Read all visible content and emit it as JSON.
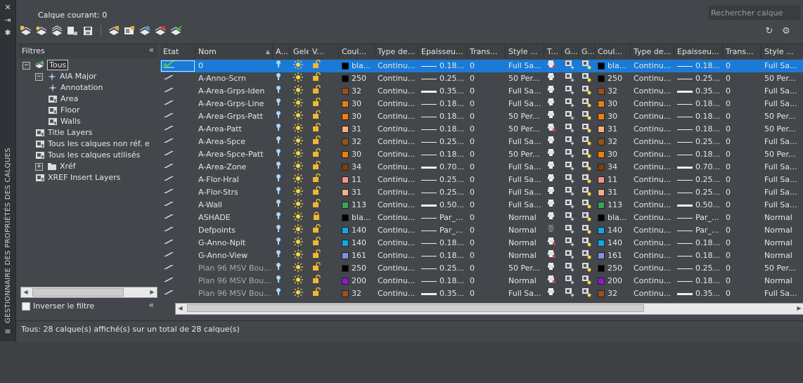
{
  "panel_title": "GESTIONNAIRE DES PROPRIÉTÉS DES CALQUES",
  "current_layer_label": "Calque courant: 0",
  "search_placeholder": "Rechercher calque",
  "filters_title": "Filtres",
  "invert_filter_label": "Inverser le filtre",
  "status_text": "Tous: 28 calque(s) affiché(s) sur un total de 28 calque(s)",
  "filter_tree": [
    {
      "label": "Tous",
      "level": 0,
      "expander": "minus",
      "icon": "filter-all-icon",
      "selected": true
    },
    {
      "label": "AIA Major",
      "level": 1,
      "expander": "minus",
      "icon": "group-filter-icon"
    },
    {
      "label": "Annotation",
      "level": 2,
      "icon": "group-filter-icon"
    },
    {
      "label": "Area",
      "level": 2,
      "icon": "property-filter-icon"
    },
    {
      "label": "Floor",
      "level": 2,
      "icon": "property-filter-icon"
    },
    {
      "label": "Walls",
      "level": 2,
      "icon": "property-filter-icon"
    },
    {
      "label": "Title Layers",
      "level": 1,
      "icon": "property-filter-icon"
    },
    {
      "label": "Tous les calques non réf. e",
      "level": 1,
      "icon": "property-filter-icon"
    },
    {
      "label": "Tous les calques utilisés",
      "level": 1,
      "icon": "property-filter-icon"
    },
    {
      "label": "Xréf",
      "level": 1,
      "expander": "plus",
      "icon": "xref-filter-icon"
    },
    {
      "label": "XREF Insert Layers",
      "level": 1,
      "icon": "property-filter-icon"
    }
  ],
  "columns": [
    "Etat",
    "Nom",
    "A...",
    "Geler",
    "V...",
    "Coul...",
    "Type de...",
    "Epaisseu...",
    "Trans...",
    "Style ...",
    "T...",
    "G...",
    "G...",
    "Coul...",
    "Type de...",
    "Epaisseu...",
    "Trans...",
    "Style ..."
  ],
  "layers": [
    {
      "name": "0",
      "color_label": "bla...",
      "color": "#000000",
      "ltype": "Continu...",
      "lweight": "0.18...",
      "thick": false,
      "trans": "0",
      "style": "Full Sa...",
      "selected": true,
      "current": true,
      "print": "plot-red"
    },
    {
      "name": "A-Anno-Scrn",
      "color_label": "250",
      "color": "#000000",
      "ltype": "Continu...",
      "lweight": "0.25...",
      "thick": false,
      "trans": "0",
      "style": "50 Per...",
      "print": "plot"
    },
    {
      "name": "A-Area-Grps-Iden",
      "color_label": "32",
      "color": "#9a5218",
      "ltype": "Continu...",
      "lweight": "0.35...",
      "thick": true,
      "trans": "0",
      "style": "Full Sa...",
      "print": "plot"
    },
    {
      "name": "A-Area-Grps-Line",
      "color_label": "30",
      "color": "#f07c12",
      "ltype": "Continu...",
      "lweight": "0.18...",
      "thick": false,
      "trans": "0",
      "style": "Full Sa...",
      "print": "plot"
    },
    {
      "name": "A-Area-Grps-Patt",
      "color_label": "30",
      "color": "#f07c12",
      "ltype": "Continu...",
      "lweight": "0.18...",
      "thick": false,
      "trans": "0",
      "style": "50 Per...",
      "print": "plot"
    },
    {
      "name": "A-Area-Patt",
      "color_label": "31",
      "color": "#f5b083",
      "ltype": "Continu...",
      "lweight": "0.18...",
      "thick": false,
      "trans": "0",
      "style": "50 Per...",
      "print": "plot-red"
    },
    {
      "name": "A-Area-Spce",
      "color_label": "32",
      "color": "#9a5218",
      "ltype": "Continu...",
      "lweight": "0.25...",
      "thick": false,
      "trans": "0",
      "style": "Full Sa...",
      "print": "plot"
    },
    {
      "name": "A-Area-Spce-Patt",
      "color_label": "30",
      "color": "#f07c12",
      "ltype": "Continu...",
      "lweight": "0.18...",
      "thick": false,
      "trans": "0",
      "style": "50 Per...",
      "print": "plot"
    },
    {
      "name": "A-Area-Zone",
      "color_label": "34",
      "color": "#7a3e10",
      "ltype": "Continu...",
      "lweight": "0.70...",
      "thick": true,
      "trans": "0",
      "style": "Full Sa...",
      "print": "plot"
    },
    {
      "name": "A-Flor-Hral",
      "color_label": "11",
      "color": "#f59090",
      "ltype": "Continu...",
      "lweight": "0.25...",
      "thick": false,
      "trans": "0",
      "style": "Full Sa...",
      "print": "plot"
    },
    {
      "name": "A-Flor-Strs",
      "color_label": "31",
      "color": "#f5b083",
      "ltype": "Continu...",
      "lweight": "0.25...",
      "thick": false,
      "trans": "0",
      "style": "Full Sa...",
      "print": "plot"
    },
    {
      "name": "A-Wall",
      "color_label": "113",
      "color": "#3aa55a",
      "ltype": "Continu...",
      "lweight": "0.50...",
      "thick": true,
      "trans": "0",
      "style": "Full Sa...",
      "print": "plot"
    },
    {
      "name": "ASHADE",
      "color_label": "bla...",
      "color": "#000000",
      "ltype": "Continu...",
      "lweight": "Par_...",
      "thick": false,
      "trans": "0",
      "style": "Normal",
      "print": "plot",
      "locked": true
    },
    {
      "name": "Defpoints",
      "color_label": "140",
      "color": "#12a8e6",
      "ltype": "Continu...",
      "lweight": "Par_...",
      "thick": false,
      "trans": "0",
      "style": "Normal",
      "print": "noplot"
    },
    {
      "name": "G-Anno-Nplt",
      "color_label": "140",
      "color": "#12a8e6",
      "ltype": "Continu...",
      "lweight": "0.18...",
      "thick": false,
      "trans": "0",
      "style": "Normal",
      "print": "plot-red"
    },
    {
      "name": "G-Anno-View",
      "color_label": "161",
      "color": "#7f8fe6",
      "ltype": "Continu...",
      "lweight": "0.18...",
      "thick": false,
      "trans": "0",
      "style": "Normal",
      "print": "plot-red"
    },
    {
      "name": "Plan 96 MSV Bou...",
      "color_label": "250",
      "color": "#000000",
      "ltype": "Continu...",
      "lweight": "0.25...",
      "thick": false,
      "trans": "0",
      "style": "50 Per...",
      "print": "plot",
      "dim": true
    },
    {
      "name": "Plan 96 MSV Bou...",
      "color_label": "200",
      "color": "#9a12d6",
      "ltype": "Continu...",
      "lweight": "0.18...",
      "thick": false,
      "trans": "0",
      "style": "Normal",
      "print": "plot-red",
      "dim": true
    },
    {
      "name": "Plan 96 MSV Bou...",
      "color_label": "32",
      "color": "#9a5218",
      "ltype": "Continu...",
      "lweight": "0.35...",
      "thick": true,
      "trans": "0",
      "style": "Full Sa...",
      "print": "plot",
      "dim": true
    }
  ]
}
